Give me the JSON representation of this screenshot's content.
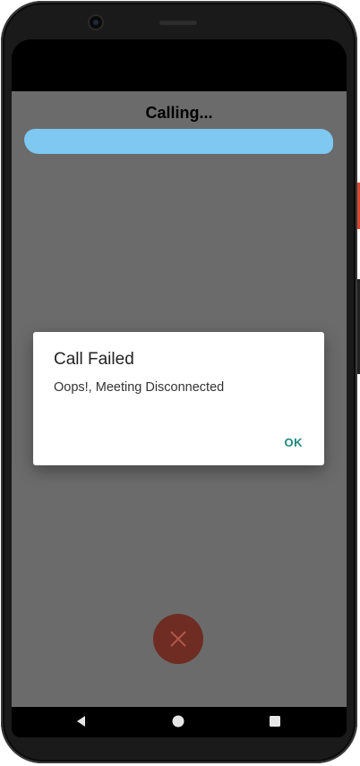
{
  "call_screen": {
    "status_title": "Calling...",
    "callee_name": ""
  },
  "dialog": {
    "title": "Call Failed",
    "message": "Oops!, Meeting Disconnected",
    "ok_label": "OK"
  },
  "colors": {
    "overlay_background": "#6b6b6b",
    "redaction": "#7ec8f2",
    "end_call_button": "#6e2c22",
    "dialog_accent": "#1a8a7a"
  },
  "icons": {
    "end_call": "close-icon",
    "nav_back": "triangle-back-icon",
    "nav_home": "circle-home-icon",
    "nav_recents": "square-recents-icon"
  }
}
